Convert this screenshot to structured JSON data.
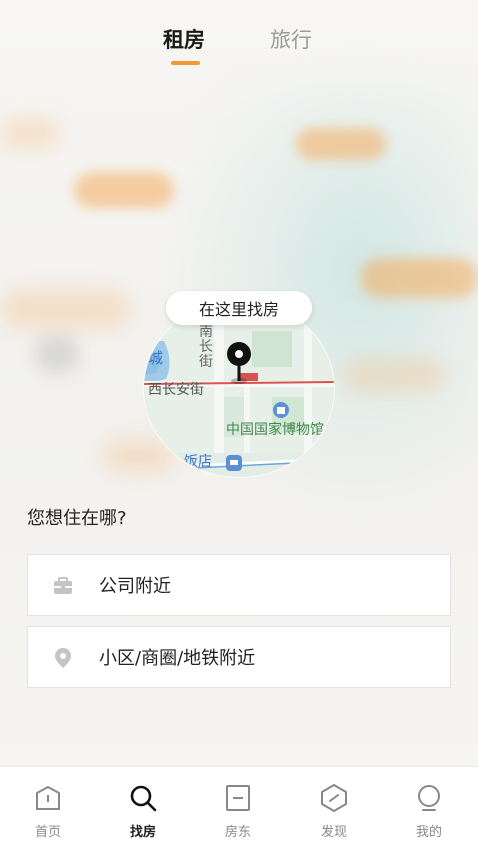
{
  "tabs": [
    {
      "label": "租房",
      "active": true
    },
    {
      "label": "旅行",
      "active": false
    }
  ],
  "accent_color": "#f29a32",
  "map": {
    "pin_label": "在这里找房",
    "labels": [
      "城",
      "南长街",
      "西长安街",
      "中国国家博物馆",
      "饭店"
    ]
  },
  "question": "您想住在哪?",
  "options": [
    {
      "label": "公司附近",
      "icon": "briefcase-icon"
    },
    {
      "label": "小区/商圈/地铁附近",
      "icon": "location-pin-icon"
    }
  ],
  "bottom_nav": [
    {
      "label": "首页",
      "icon": "home-icon",
      "active": false
    },
    {
      "label": "找房",
      "icon": "search-icon",
      "active": true
    },
    {
      "label": "房东",
      "icon": "landlord-icon",
      "active": false
    },
    {
      "label": "发现",
      "icon": "discover-icon",
      "active": false
    },
    {
      "label": "我的",
      "icon": "profile-icon",
      "active": false
    }
  ]
}
